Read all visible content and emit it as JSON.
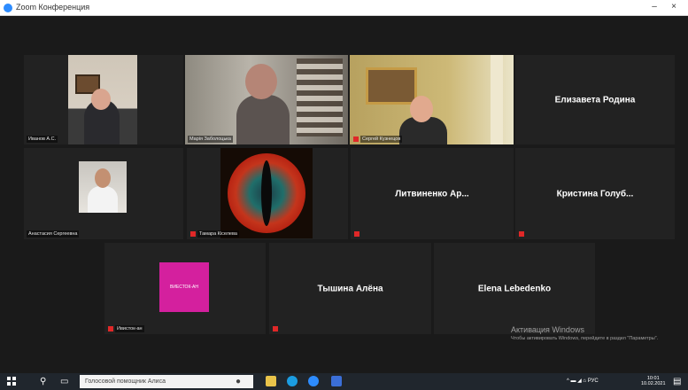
{
  "window": {
    "title": "Zoom Конференция",
    "minimize": "–",
    "close": "×"
  },
  "participants": [
    {
      "label": "Иванов А.С."
    },
    {
      "label": "Марія Заболоцька"
    },
    {
      "label": "Сергей Кузнецов"
    },
    {
      "name": "Елизавета Родина"
    },
    {
      "label": "Анастасия Сергеевна"
    },
    {
      "label": "Тамара Кіселева"
    },
    {
      "name": "Литвиненко Ар..."
    },
    {
      "name": "Кристина Голуб..."
    },
    {
      "label": "Ивисток-ан",
      "image_text": "ВИЕСТОК-АН"
    },
    {
      "name": "Тышина Алёна"
    },
    {
      "name": "Elena Lebedenko"
    }
  ],
  "watermark": {
    "title": "Активация Windows",
    "subtitle": "Чтобы активировать Windows, перейдите в раздел \"Параметры\"."
  },
  "taskbar": {
    "search_placeholder": "Голосовой помощник Алиса",
    "tray": "^ ▬ ◢ ⌂ РУС",
    "time": "10:01",
    "date": "10.02.2021"
  },
  "colors": {
    "active_speaker": "#8bd14b",
    "mute": "#e02828",
    "tile_bg": "#222222"
  }
}
